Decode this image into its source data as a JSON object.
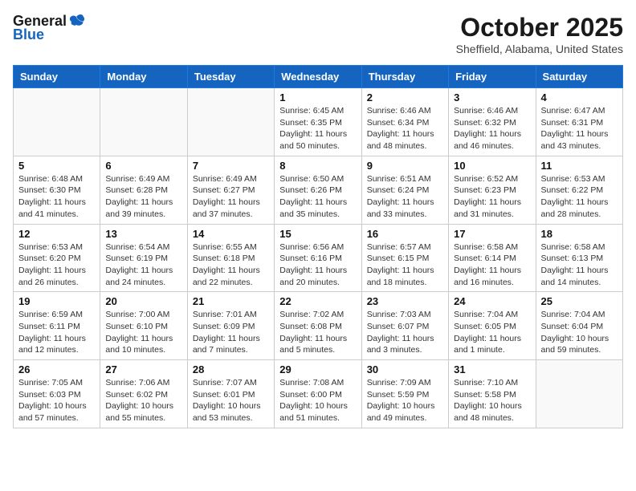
{
  "header": {
    "logo_general": "General",
    "logo_blue": "Blue",
    "month": "October 2025",
    "location": "Sheffield, Alabama, United States"
  },
  "weekdays": [
    "Sunday",
    "Monday",
    "Tuesday",
    "Wednesday",
    "Thursday",
    "Friday",
    "Saturday"
  ],
  "weeks": [
    [
      {
        "day": "",
        "info": ""
      },
      {
        "day": "",
        "info": ""
      },
      {
        "day": "",
        "info": ""
      },
      {
        "day": "1",
        "info": "Sunrise: 6:45 AM\nSunset: 6:35 PM\nDaylight: 11 hours and 50 minutes."
      },
      {
        "day": "2",
        "info": "Sunrise: 6:46 AM\nSunset: 6:34 PM\nDaylight: 11 hours and 48 minutes."
      },
      {
        "day": "3",
        "info": "Sunrise: 6:46 AM\nSunset: 6:32 PM\nDaylight: 11 hours and 46 minutes."
      },
      {
        "day": "4",
        "info": "Sunrise: 6:47 AM\nSunset: 6:31 PM\nDaylight: 11 hours and 43 minutes."
      }
    ],
    [
      {
        "day": "5",
        "info": "Sunrise: 6:48 AM\nSunset: 6:30 PM\nDaylight: 11 hours and 41 minutes."
      },
      {
        "day": "6",
        "info": "Sunrise: 6:49 AM\nSunset: 6:28 PM\nDaylight: 11 hours and 39 minutes."
      },
      {
        "day": "7",
        "info": "Sunrise: 6:49 AM\nSunset: 6:27 PM\nDaylight: 11 hours and 37 minutes."
      },
      {
        "day": "8",
        "info": "Sunrise: 6:50 AM\nSunset: 6:26 PM\nDaylight: 11 hours and 35 minutes."
      },
      {
        "day": "9",
        "info": "Sunrise: 6:51 AM\nSunset: 6:24 PM\nDaylight: 11 hours and 33 minutes."
      },
      {
        "day": "10",
        "info": "Sunrise: 6:52 AM\nSunset: 6:23 PM\nDaylight: 11 hours and 31 minutes."
      },
      {
        "day": "11",
        "info": "Sunrise: 6:53 AM\nSunset: 6:22 PM\nDaylight: 11 hours and 28 minutes."
      }
    ],
    [
      {
        "day": "12",
        "info": "Sunrise: 6:53 AM\nSunset: 6:20 PM\nDaylight: 11 hours and 26 minutes."
      },
      {
        "day": "13",
        "info": "Sunrise: 6:54 AM\nSunset: 6:19 PM\nDaylight: 11 hours and 24 minutes."
      },
      {
        "day": "14",
        "info": "Sunrise: 6:55 AM\nSunset: 6:18 PM\nDaylight: 11 hours and 22 minutes."
      },
      {
        "day": "15",
        "info": "Sunrise: 6:56 AM\nSunset: 6:16 PM\nDaylight: 11 hours and 20 minutes."
      },
      {
        "day": "16",
        "info": "Sunrise: 6:57 AM\nSunset: 6:15 PM\nDaylight: 11 hours and 18 minutes."
      },
      {
        "day": "17",
        "info": "Sunrise: 6:58 AM\nSunset: 6:14 PM\nDaylight: 11 hours and 16 minutes."
      },
      {
        "day": "18",
        "info": "Sunrise: 6:58 AM\nSunset: 6:13 PM\nDaylight: 11 hours and 14 minutes."
      }
    ],
    [
      {
        "day": "19",
        "info": "Sunrise: 6:59 AM\nSunset: 6:11 PM\nDaylight: 11 hours and 12 minutes."
      },
      {
        "day": "20",
        "info": "Sunrise: 7:00 AM\nSunset: 6:10 PM\nDaylight: 11 hours and 10 minutes."
      },
      {
        "day": "21",
        "info": "Sunrise: 7:01 AM\nSunset: 6:09 PM\nDaylight: 11 hours and 7 minutes."
      },
      {
        "day": "22",
        "info": "Sunrise: 7:02 AM\nSunset: 6:08 PM\nDaylight: 11 hours and 5 minutes."
      },
      {
        "day": "23",
        "info": "Sunrise: 7:03 AM\nSunset: 6:07 PM\nDaylight: 11 hours and 3 minutes."
      },
      {
        "day": "24",
        "info": "Sunrise: 7:04 AM\nSunset: 6:05 PM\nDaylight: 11 hours and 1 minute."
      },
      {
        "day": "25",
        "info": "Sunrise: 7:04 AM\nSunset: 6:04 PM\nDaylight: 10 hours and 59 minutes."
      }
    ],
    [
      {
        "day": "26",
        "info": "Sunrise: 7:05 AM\nSunset: 6:03 PM\nDaylight: 10 hours and 57 minutes."
      },
      {
        "day": "27",
        "info": "Sunrise: 7:06 AM\nSunset: 6:02 PM\nDaylight: 10 hours and 55 minutes."
      },
      {
        "day": "28",
        "info": "Sunrise: 7:07 AM\nSunset: 6:01 PM\nDaylight: 10 hours and 53 minutes."
      },
      {
        "day": "29",
        "info": "Sunrise: 7:08 AM\nSunset: 6:00 PM\nDaylight: 10 hours and 51 minutes."
      },
      {
        "day": "30",
        "info": "Sunrise: 7:09 AM\nSunset: 5:59 PM\nDaylight: 10 hours and 49 minutes."
      },
      {
        "day": "31",
        "info": "Sunrise: 7:10 AM\nSunset: 5:58 PM\nDaylight: 10 hours and 48 minutes."
      },
      {
        "day": "",
        "info": ""
      }
    ]
  ]
}
